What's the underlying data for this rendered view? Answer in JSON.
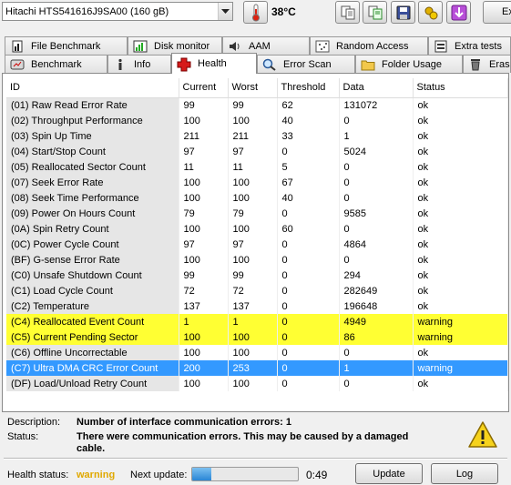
{
  "drive": {
    "selected": "Hitachi HTS541616J9SA00 (160 gB)"
  },
  "temperature": "38°C",
  "toolbar": {
    "exit_label": "Ex"
  },
  "tabs_row1": [
    {
      "label": "File Benchmark",
      "icon": "file-benchmark-icon"
    },
    {
      "label": "Disk monitor",
      "icon": "disk-monitor-icon"
    },
    {
      "label": "AAM",
      "icon": "speaker-icon"
    },
    {
      "label": "Random Access",
      "icon": "random-access-icon"
    },
    {
      "label": "Extra tests",
      "icon": "extra-tests-icon"
    }
  ],
  "tabs_row2": [
    {
      "label": "Benchmark",
      "icon": "benchmark-icon"
    },
    {
      "label": "Info",
      "icon": "info-icon"
    },
    {
      "label": "Health",
      "icon": "health-cross-icon"
    },
    {
      "label": "Error Scan",
      "icon": "magnifier-icon"
    },
    {
      "label": "Folder Usage",
      "icon": "folder-icon"
    },
    {
      "label": "Erase",
      "icon": "erase-icon"
    }
  ],
  "table": {
    "columns": [
      "ID",
      "Current",
      "Worst",
      "Threshold",
      "Data",
      "Status"
    ],
    "rows": [
      [
        "(01) Raw Read Error Rate",
        "99",
        "99",
        "62",
        "131072",
        "ok"
      ],
      [
        "(02) Throughput Performance",
        "100",
        "100",
        "40",
        "0",
        "ok"
      ],
      [
        "(03) Spin Up Time",
        "211",
        "211",
        "33",
        "1",
        "ok"
      ],
      [
        "(04) Start/Stop Count",
        "97",
        "97",
        "0",
        "5024",
        "ok"
      ],
      [
        "(05) Reallocated Sector Count",
        "11",
        "11",
        "5",
        "0",
        "ok"
      ],
      [
        "(07) Seek Error Rate",
        "100",
        "100",
        "67",
        "0",
        "ok"
      ],
      [
        "(08) Seek Time Performance",
        "100",
        "100",
        "40",
        "0",
        "ok"
      ],
      [
        "(09) Power On Hours Count",
        "79",
        "79",
        "0",
        "9585",
        "ok"
      ],
      [
        "(0A) Spin Retry Count",
        "100",
        "100",
        "60",
        "0",
        "ok"
      ],
      [
        "(0C) Power Cycle Count",
        "97",
        "97",
        "0",
        "4864",
        "ok"
      ],
      [
        "(BF) G-sense Error Rate",
        "100",
        "100",
        "0",
        "0",
        "ok"
      ],
      [
        "(C0) Unsafe Shutdown Count",
        "99",
        "99",
        "0",
        "294",
        "ok"
      ],
      [
        "(C1) Load Cycle Count",
        "72",
        "72",
        "0",
        "282649",
        "ok"
      ],
      [
        "(C2) Temperature",
        "137",
        "137",
        "0",
        "196648",
        "ok"
      ],
      [
        "(C4) Reallocated Event Count",
        "1",
        "1",
        "0",
        "4949",
        "warning"
      ],
      [
        "(C5) Current Pending Sector",
        "100",
        "100",
        "0",
        "86",
        "warning"
      ],
      [
        "(C6) Offline Uncorrectable",
        "100",
        "100",
        "0",
        "0",
        "ok"
      ],
      [
        "(C7) Ultra DMA CRC Error Count",
        "200",
        "253",
        "0",
        "1",
        "warning"
      ],
      [
        "(DF) Load/Unload Retry Count",
        "100",
        "100",
        "0",
        "0",
        "ok"
      ]
    ],
    "highlight": {
      "warning_rows": [
        14,
        15
      ],
      "selected_row": 17
    }
  },
  "description": {
    "description_label": "Description:",
    "description_value": "Number of interface communication errors: 1",
    "status_label": "Status:",
    "status_value": "There were communication errors. This may be caused by a damaged cable."
  },
  "footer": {
    "health_status_label": "Health status:",
    "health_status_value": "warning",
    "next_update_label": "Next update:",
    "countdown": "0:49",
    "progress_percent": 18,
    "update_button": "Update",
    "log_button": "Log"
  },
  "colors": {
    "warning_row": "#ffff33",
    "selected_row": "#3399ff",
    "health_status": "#e0a800"
  }
}
